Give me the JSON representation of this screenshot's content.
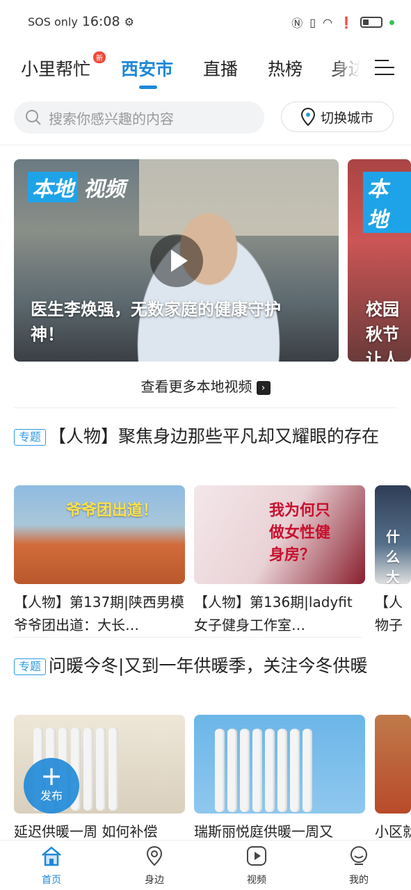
{
  "status_bar": {
    "carrier": "SOS only",
    "time": "16:08"
  },
  "tabs": [
    {
      "label": "小里帮忙",
      "badge": "新"
    },
    {
      "label": "西安市"
    },
    {
      "label": "直播"
    },
    {
      "label": "热榜"
    },
    {
      "label": "身边"
    }
  ],
  "search": {
    "placeholder": "搜索你感兴趣的内容"
  },
  "city_button": "切换城市",
  "local_videos": {
    "tag_a": "本地",
    "tag_b": "视频",
    "items": [
      {
        "caption": "医生李焕强，无数家庭的健康守护神！"
      },
      {
        "caption": "校园秋节让人"
      }
    ],
    "more_label": "查看更多本地视频"
  },
  "topics": [
    {
      "tag": "专题",
      "title": "【人物】聚焦身边那些平凡却又耀眼的存在",
      "cards": [
        {
          "title": "【人物】第137期|陕西男模爷爷团出道：大长…",
          "thumb_text": "爷爷团出道！"
        },
        {
          "title": "【人物】第136期|ladyfit女子健身工作室…",
          "thumb_text": "我为何只做女性健身房？"
        },
        {
          "title": "【人物子也想",
          "thumb_text": "什么大"
        }
      ]
    },
    {
      "tag": "专题",
      "title": "问暖今冬|又到一年供暖季，关注今冬供暖",
      "cards": [
        {
          "title": "延迟供暖一周 如何补偿"
        },
        {
          "title": "瑞斯丽悦庭供暖一周又"
        },
        {
          "title": "小区就"
        }
      ]
    }
  ],
  "fab": {
    "label": "发布"
  },
  "bottom_nav": [
    {
      "label": "首页",
      "icon": "home-icon"
    },
    {
      "label": "身边",
      "icon": "location-icon"
    },
    {
      "label": "视频",
      "icon": "video-icon"
    },
    {
      "label": "我的",
      "icon": "profile-icon"
    }
  ],
  "colors": {
    "accent": "#1e88d8",
    "tag_blue": "#2a9be0",
    "badge_red": "#ee4a3b"
  }
}
